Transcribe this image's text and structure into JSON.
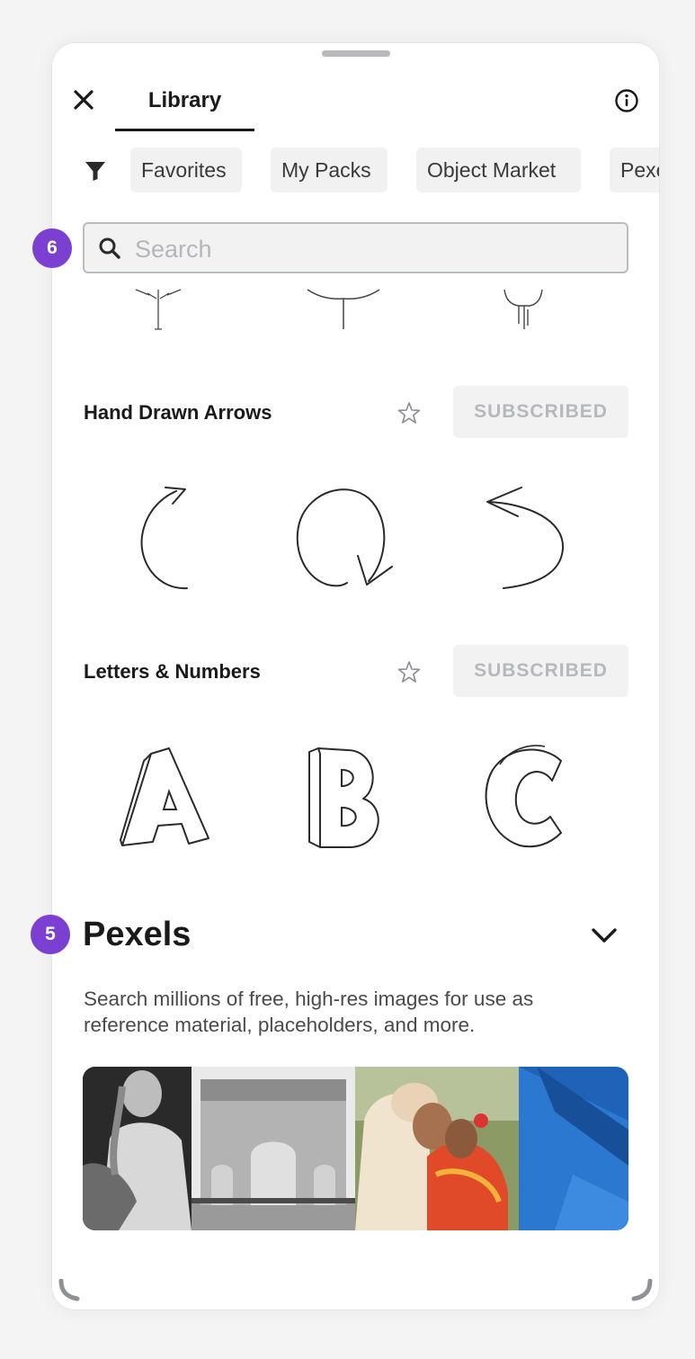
{
  "header": {
    "tab_label": "Library",
    "close_icon": "close-icon",
    "info_icon": "info-icon"
  },
  "filters": {
    "icon": "filter-icon",
    "chips": [
      "Favorites",
      "My Packs",
      "Object Market",
      "Pexels"
    ]
  },
  "search": {
    "placeholder": "Search",
    "value": ""
  },
  "annotations": {
    "search_badge": "6",
    "pexels_badge": "5",
    "badge_color": "#7b3fd1"
  },
  "packs": [
    {
      "title": "Hand Drawn Arrows",
      "action_label": "SUBSCRIBED",
      "star_icon": "star-outline-icon",
      "stickers": [
        "curved-arrow-up-right",
        "loop-arrow",
        "curved-arrow-back-left"
      ]
    },
    {
      "title": "Letters & Numbers",
      "action_label": "SUBSCRIBED",
      "star_icon": "star-outline-icon",
      "stickers": [
        "letter-A",
        "letter-B",
        "letter-C"
      ]
    }
  ],
  "pexels": {
    "title": "Pexels",
    "description": "Search millions of free, high-res images for use as reference material, placeholders, and more.",
    "toggle_icon": "chevron-down-icon",
    "photos": [
      "girl-with-dog-bw",
      "triumphal-arch-bw",
      "wedding-couple",
      "blue-pool-steps"
    ]
  },
  "colors": {
    "accent": "#7b3fd1",
    "chip_bg": "#f1f1f2",
    "subscribed_text": "#b6b8bb",
    "text_primary": "#1a1a1a"
  }
}
